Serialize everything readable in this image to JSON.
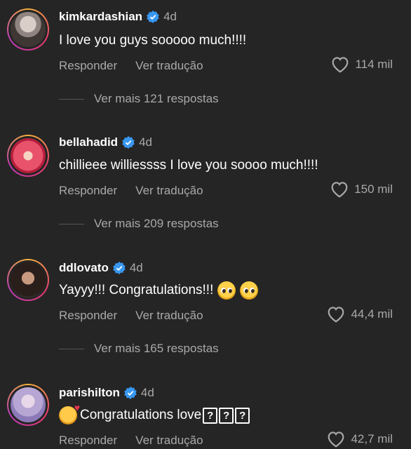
{
  "actions": {
    "reply_label": "Responder",
    "translate_label": "Ver tradução"
  },
  "comments": [
    {
      "username": "kimkardashian",
      "time": "4d",
      "text": "I love you guys sooooo much!!!!",
      "likes": "114 mil",
      "replies": "Ver mais 121 respostas"
    },
    {
      "username": "bellahadid",
      "time": "4d",
      "text": "chillieee williessss I love you soooo much!!!!",
      "likes": "150 mil",
      "replies": "Ver mais 209 respostas"
    },
    {
      "username": "ddlovato",
      "time": "4d",
      "text": "Yayyy!!! Congratulations!!!",
      "likes": "44,4 mil",
      "replies": "Ver mais 165 respostas"
    },
    {
      "username": "parishilton",
      "time": "4d",
      "text": "Congratulations love",
      "likes": "42,7 mil",
      "unknown_glyph": "?"
    }
  ],
  "colors": {
    "background": "#252525",
    "muted": "#a9a9a9",
    "verified": "#3897f0"
  }
}
